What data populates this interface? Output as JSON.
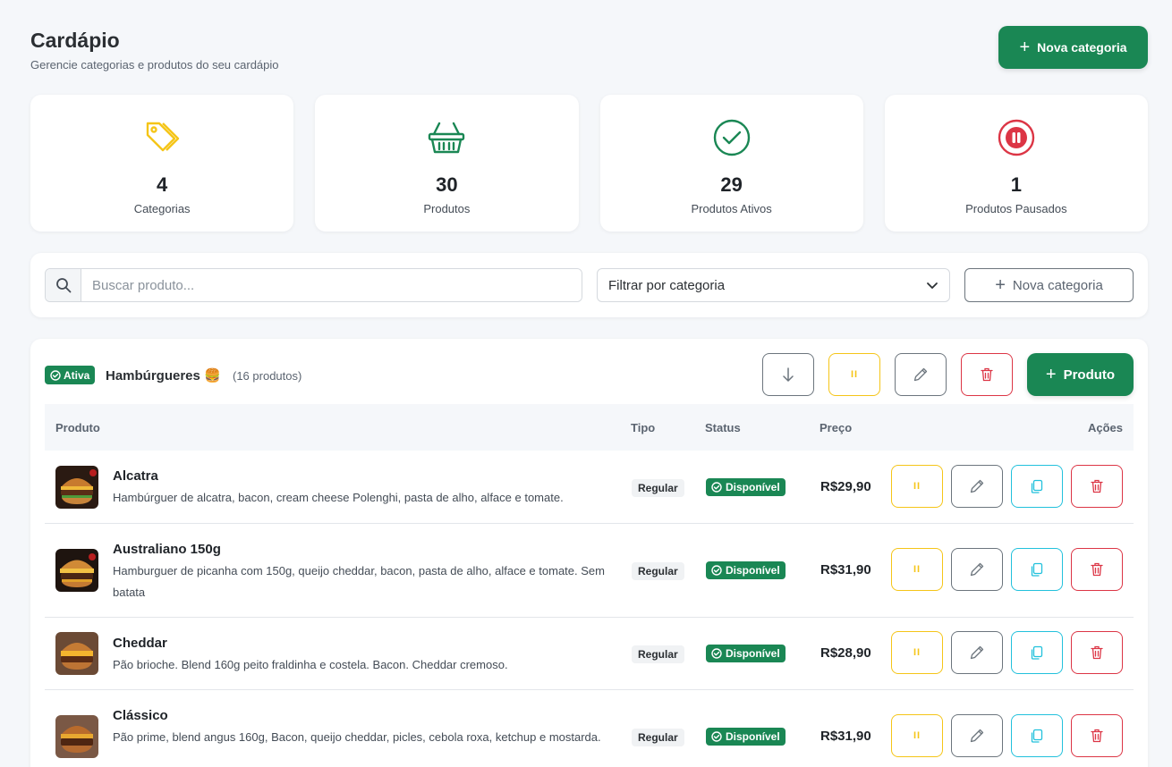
{
  "header": {
    "title": "Cardápio",
    "subtitle": "Gerencie categorias e produtos do seu cardápio",
    "new_category_label": "Nova categoria"
  },
  "stats": [
    {
      "value": "4",
      "label": "Categorias",
      "icon": "tags-icon",
      "color": "#f5c518"
    },
    {
      "value": "30",
      "label": "Produtos",
      "icon": "basket-icon",
      "color": "#1a8754"
    },
    {
      "value": "29",
      "label": "Produtos Ativos",
      "icon": "check-circle-icon",
      "color": "#1a8754"
    },
    {
      "value": "1",
      "label": "Produtos Pausados",
      "icon": "pause-circle-icon",
      "color": "#dc3545"
    }
  ],
  "filters": {
    "search_placeholder": "Buscar produto...",
    "search_value": "",
    "category_select": "Filtrar por categoria",
    "new_category_label": "Nova categoria"
  },
  "category": {
    "status": "Ativa",
    "name": "Hambúrgueres 🍔",
    "count": "(16 produtos)",
    "add_product_label": "Produto"
  },
  "table": {
    "headers": {
      "product": "Produto",
      "type": "Tipo",
      "status": "Status",
      "price": "Preço",
      "actions": "Ações"
    },
    "rows": [
      {
        "name": "Alcatra",
        "desc": "Hambúrguer de alcatra, bacon, cream cheese Polenghi, pasta de alho, alface e tomate.",
        "type": "Regular",
        "status": "Disponível",
        "price": "R$29,90"
      },
      {
        "name": "Australiano 150g",
        "desc": "Hamburguer de picanha com 150g, queijo cheddar, bacon, pasta de alho, alface e tomate. Sem batata",
        "type": "Regular",
        "status": "Disponível",
        "price": "R$31,90"
      },
      {
        "name": "Cheddar",
        "desc": "Pão brioche. Blend 160g peito fraldinha e costela. Bacon. Cheddar cremoso.",
        "type": "Regular",
        "status": "Disponível",
        "price": "R$28,90"
      },
      {
        "name": "Clássico",
        "desc": "Pão prime, blend angus 160g, Bacon, queijo cheddar, picles, cebola roxa, ketchup e mostarda.",
        "type": "Regular",
        "status": "Disponível",
        "price": "R$31,90"
      }
    ]
  },
  "colors": {
    "primary": "#1a8754",
    "warning": "#f5c518",
    "danger": "#dc3545",
    "info": "#22c1dc",
    "secondary": "#6c757d"
  }
}
